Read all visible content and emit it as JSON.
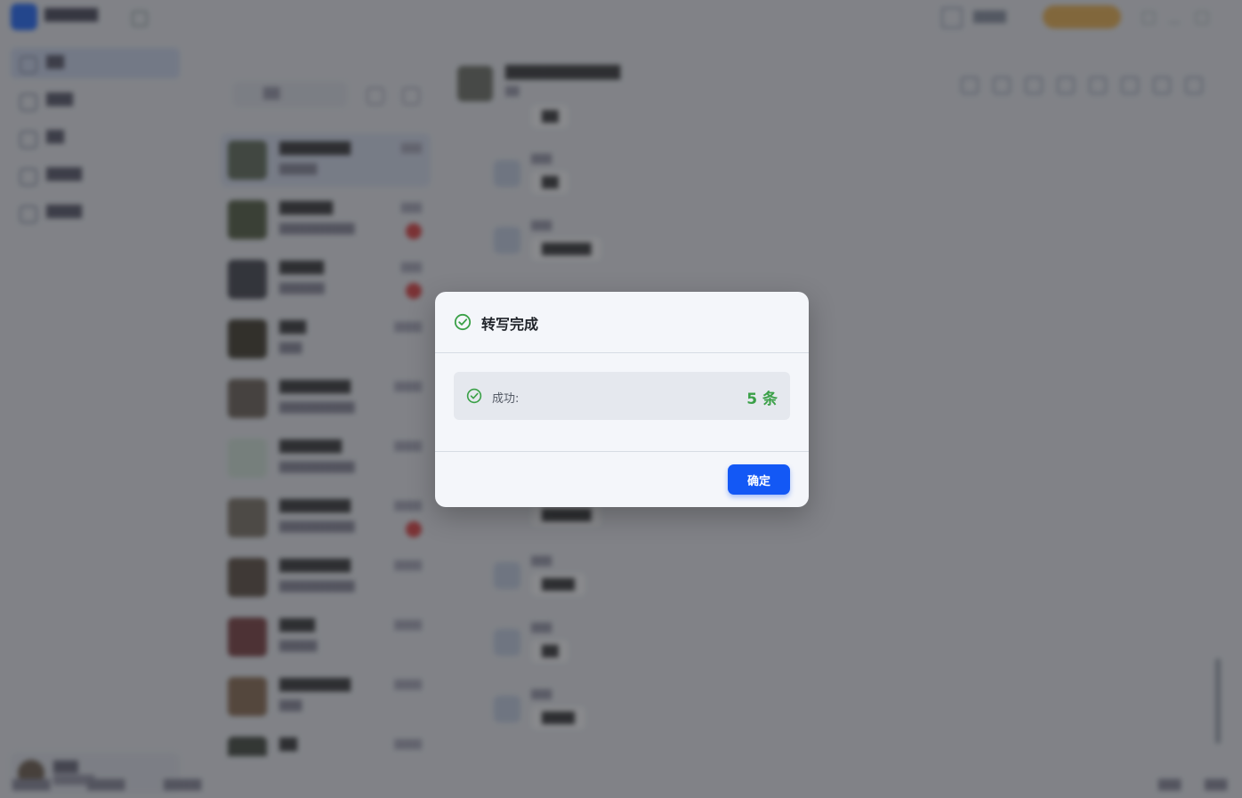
{
  "dialog": {
    "title": "转写完成",
    "success_label": "成功:",
    "success_count": "5 条",
    "confirm_label": "确定",
    "accent": "#3aa047",
    "button_color": "#1358f5"
  },
  "icons": {
    "title": "check-circle-icon",
    "result": "check-circle-icon"
  }
}
